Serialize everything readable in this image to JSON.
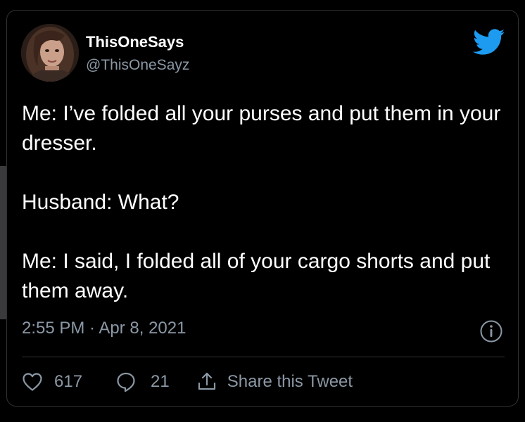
{
  "tweet": {
    "display_name": "ThisOneSays",
    "handle": "@ThisOneSayz",
    "paragraphs": [
      "Me: I’ve folded all your purses and put them in your dresser.",
      "Husband: What?",
      "Me: I said, I folded all of your cargo shorts and put them away."
    ],
    "timestamp": "2:55 PM · Apr 8, 2021"
  },
  "actions": {
    "likes": "617",
    "replies": "21",
    "share_label": "Share this Tweet"
  },
  "colors": {
    "background": "#000000",
    "text_primary": "#ffffff",
    "text_secondary": "#8b98a5",
    "twitter_blue": "#1d9bf0",
    "border": "#2f3336"
  },
  "icons": {
    "brand": "twitter-bird-icon",
    "info": "info-icon",
    "like": "heart-icon",
    "reply": "reply-bubble-icon",
    "share": "share-icon"
  }
}
